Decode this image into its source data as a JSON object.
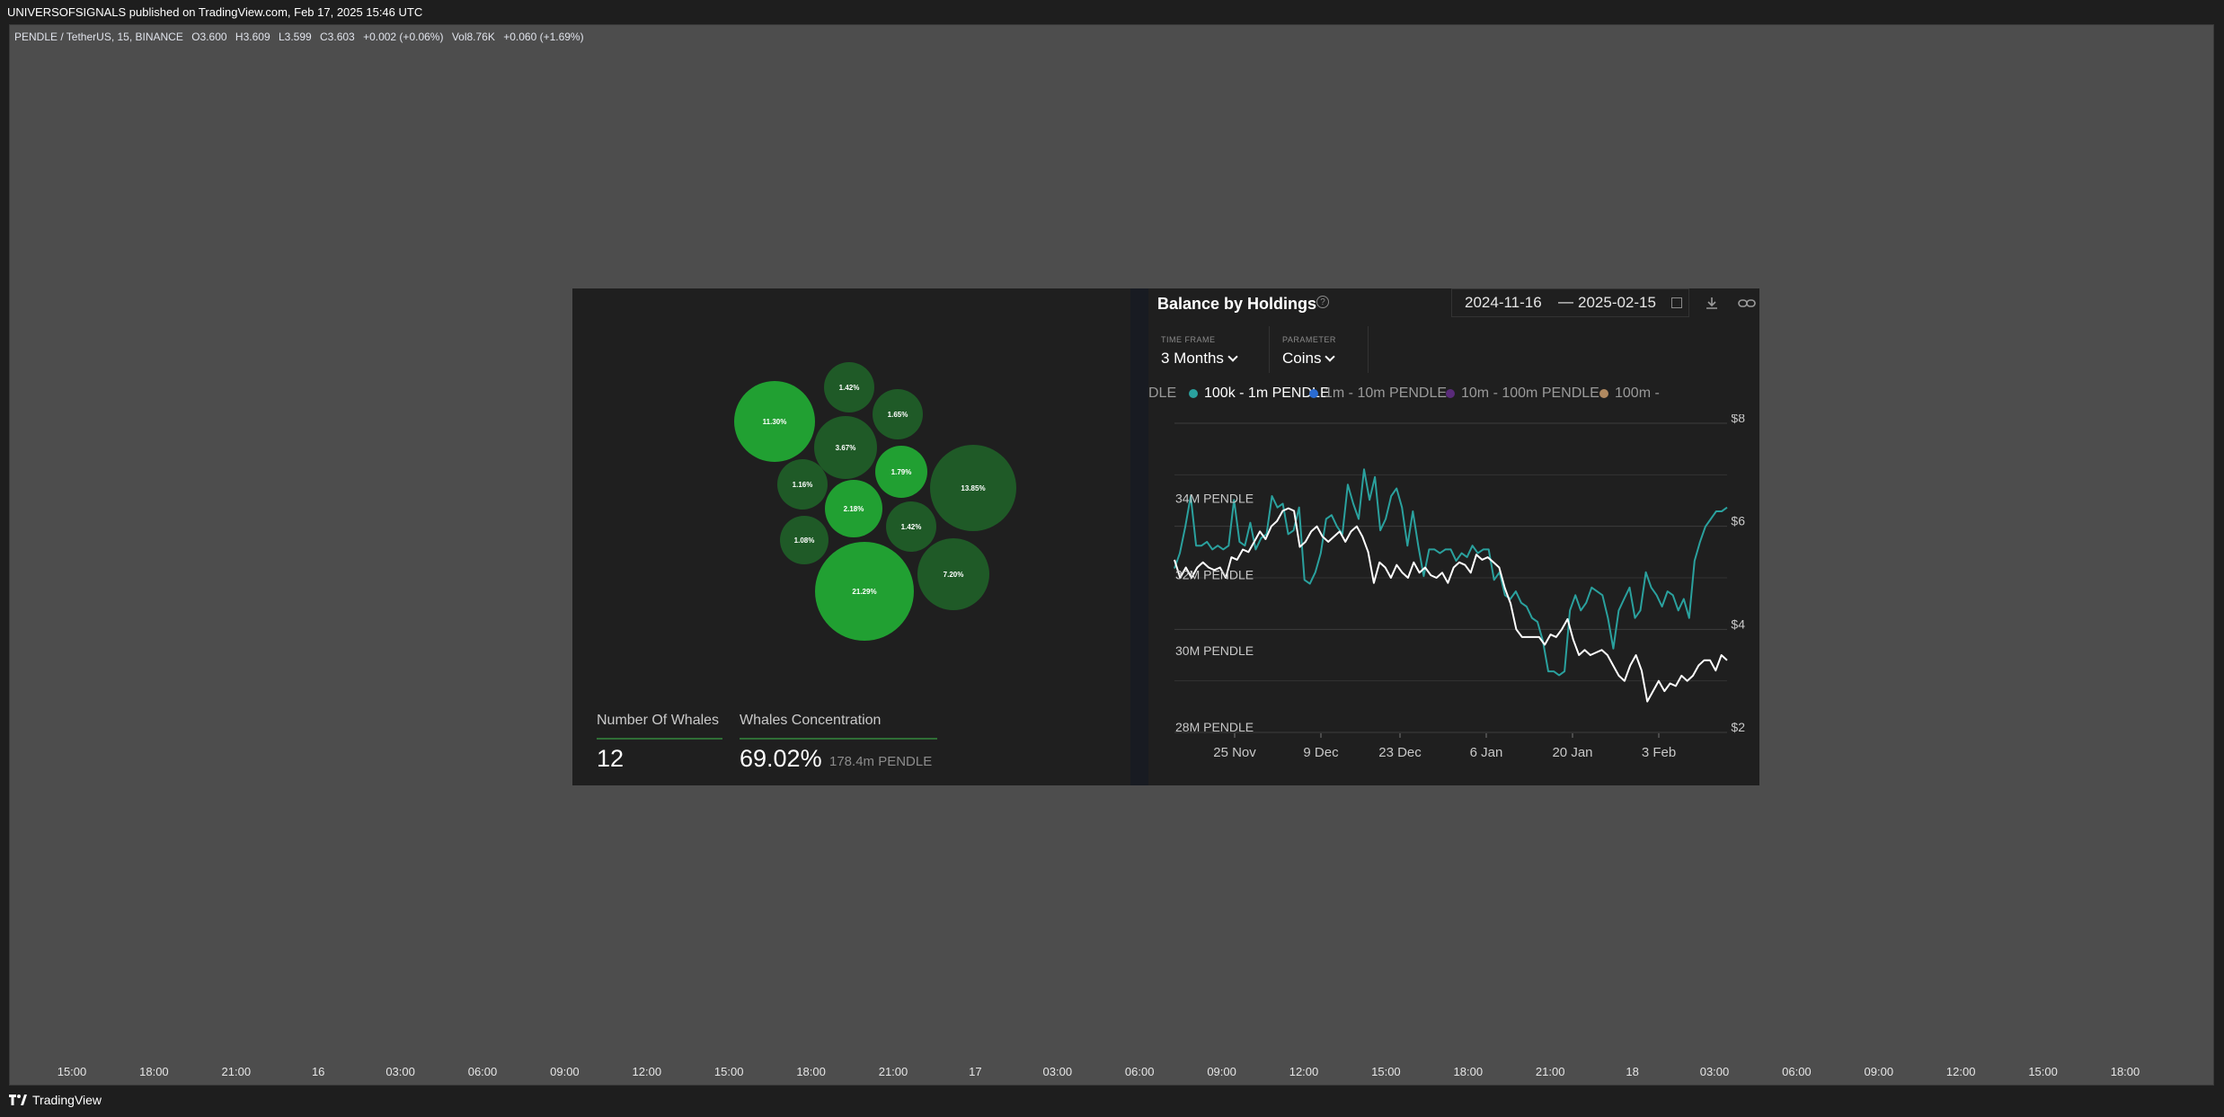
{
  "header": {
    "published": "UNIVERSOFSIGNALS published on TradingView.com, Feb 17, 2025 15:46 UTC"
  },
  "ohlc": {
    "symbol": "PENDLE / TetherUS, 15, BINANCE",
    "o": "O3.600",
    "h": "H3.609",
    "l": "L3.599",
    "c": "C3.603",
    "change": "+0.002 (+0.06%)",
    "vol": "Vol8.76K",
    "vol_change": "+0.060 (+1.69%)"
  },
  "time_axis": {
    "labels": [
      "15:00",
      "18:00",
      "21:00",
      "16",
      "03:00",
      "06:00",
      "09:00",
      "12:00",
      "15:00",
      "18:00",
      "21:00",
      "17",
      "03:00",
      "06:00",
      "09:00",
      "12:00",
      "15:00",
      "18:00",
      "21:00",
      "18",
      "03:00",
      "06:00",
      "09:00",
      "12:00",
      "15:00",
      "18:00"
    ]
  },
  "footer": {
    "brand": "TradingView"
  },
  "whales": {
    "bubbles": [
      {
        "label": "11.30%",
        "shade": "bright"
      },
      {
        "label": "1.42%",
        "shade": "dark"
      },
      {
        "label": "1.65%",
        "shade": "dark"
      },
      {
        "label": "3.67%",
        "shade": "dark"
      },
      {
        "label": "1.16%",
        "shade": "dark"
      },
      {
        "label": "1.79%",
        "shade": "bright"
      },
      {
        "label": "13.85%",
        "shade": "dark"
      },
      {
        "label": "2.18%",
        "shade": "bright"
      },
      {
        "label": "1.08%",
        "shade": "dark"
      },
      {
        "label": "1.42%",
        "shade": "dark"
      },
      {
        "label": "7.20%",
        "shade": "dark"
      },
      {
        "label": "21.29%",
        "shade": "bright"
      }
    ],
    "count_label": "Number Of Whales",
    "count_value": "12",
    "concentration_label": "Whales Concentration",
    "concentration_value": "69.02%",
    "concentration_sub": "178.4m PENDLE"
  },
  "balance": {
    "title": "Balance by Holdings",
    "date_from": "2024-11-16",
    "date_to": "2025-02-15",
    "time_frame_label": "TIME FRAME",
    "time_frame_value": "3 Months",
    "parameter_label": "PARAMETER",
    "parameter_value": "Coins",
    "legend": [
      {
        "label": "DLE",
        "color": "#1f1f1f"
      },
      {
        "label": "100k - 1m PENDLE",
        "color": "#2aa19e",
        "active": true
      },
      {
        "label": "1m - 10m PENDLE",
        "color": "#2a6bd1"
      },
      {
        "label": "10m - 100m PENDLE",
        "color": "#5a2b7a"
      },
      {
        "label": "100m -",
        "color": "#b08960"
      }
    ],
    "left_axis": [
      "34M PENDLE",
      "32M PENDLE",
      "30M PENDLE",
      "28M PENDLE"
    ],
    "right_axis": [
      "$8",
      "$6",
      "$4",
      "$2"
    ],
    "x_axis": [
      "25 Nov",
      "9 Dec",
      "23 Dec",
      "6 Jan",
      "20 Jan",
      "3 Feb"
    ]
  },
  "chart_data": {
    "type": "line",
    "x_range": [
      "2024-11-16",
      "2025-02-15"
    ],
    "ylim_left": [
      28,
      35.5
    ],
    "ylim_right": [
      2,
      8
    ],
    "y_left_ticks": [
      34,
      32,
      30,
      28
    ],
    "y_right_ticks": [
      8,
      6,
      4,
      2
    ],
    "series": [
      {
        "color": "#2aa19e",
        "axis": "left",
        "values": [
          32.3,
          32.7,
          33.4,
          34.2,
          32.9,
          32.9,
          33.0,
          32.8,
          32.9,
          32.8,
          32.9,
          34.1,
          33.0,
          32.9,
          33.5,
          32.8,
          33.1,
          33.2,
          34.2,
          33.9,
          34.0,
          33.2,
          33.3,
          33.9,
          32.0,
          31.9,
          32.2,
          32.7,
          33.6,
          33.7,
          33.4,
          33.2,
          34.5,
          34.0,
          33.6,
          34.9,
          34.1,
          34.7,
          33.3,
          33.6,
          34.2,
          34.4,
          33.9,
          32.9,
          33.8,
          32.9,
          32.1,
          32.8,
          32.8,
          32.7,
          32.8,
          32.8,
          32.5,
          32.7,
          32.6,
          32.9,
          32.7,
          32.8,
          32.8,
          32.0,
          32.2,
          31.6,
          31.5,
          31.7,
          31.4,
          31.3,
          31.0,
          30.9,
          30.4,
          29.6,
          29.6,
          29.5,
          29.6,
          31.2,
          31.6,
          31.2,
          31.4,
          31.8,
          31.7,
          31.6,
          31.0,
          30.2,
          31.2,
          31.5,
          31.8,
          31.0,
          31.2,
          32.2,
          31.8,
          31.6,
          31.3,
          31.7,
          31.6,
          31.2,
          31.5,
          31.0,
          32.5,
          33.0,
          33.4,
          33.6,
          33.8,
          33.8,
          33.9
        ]
      },
      {
        "color": "#ffffff",
        "axis": "right",
        "values": [
          5.35,
          5.0,
          5.2,
          5.0,
          5.2,
          5.3,
          5.2,
          5.15,
          5.2,
          5.0,
          5.4,
          5.35,
          5.55,
          5.5,
          5.7,
          5.9,
          5.75,
          6.0,
          6.1,
          6.3,
          6.35,
          6.3,
          5.6,
          5.7,
          5.9,
          6.0,
          5.8,
          5.7,
          5.8,
          5.9,
          5.7,
          5.9,
          6.0,
          5.8,
          5.5,
          4.9,
          5.3,
          5.2,
          5.0,
          5.25,
          5.1,
          5.0,
          5.3,
          5.1,
          5.2,
          5.05,
          5.0,
          5.1,
          4.9,
          5.2,
          5.3,
          5.25,
          5.1,
          5.45,
          5.35,
          5.4,
          5.3,
          5.2,
          4.8,
          4.5,
          4.0,
          3.85,
          3.85,
          3.85,
          3.85,
          3.7,
          3.9,
          3.85,
          4.0,
          4.2,
          3.8,
          3.5,
          3.6,
          3.5,
          3.55,
          3.6,
          3.5,
          3.3,
          3.1,
          3.0,
          3.3,
          3.5,
          3.2,
          2.6,
          2.8,
          3.0,
          2.8,
          2.95,
          2.9,
          3.1,
          3.0,
          3.1,
          3.3,
          3.4,
          3.4,
          3.2,
          3.5,
          3.4
        ]
      }
    ]
  }
}
